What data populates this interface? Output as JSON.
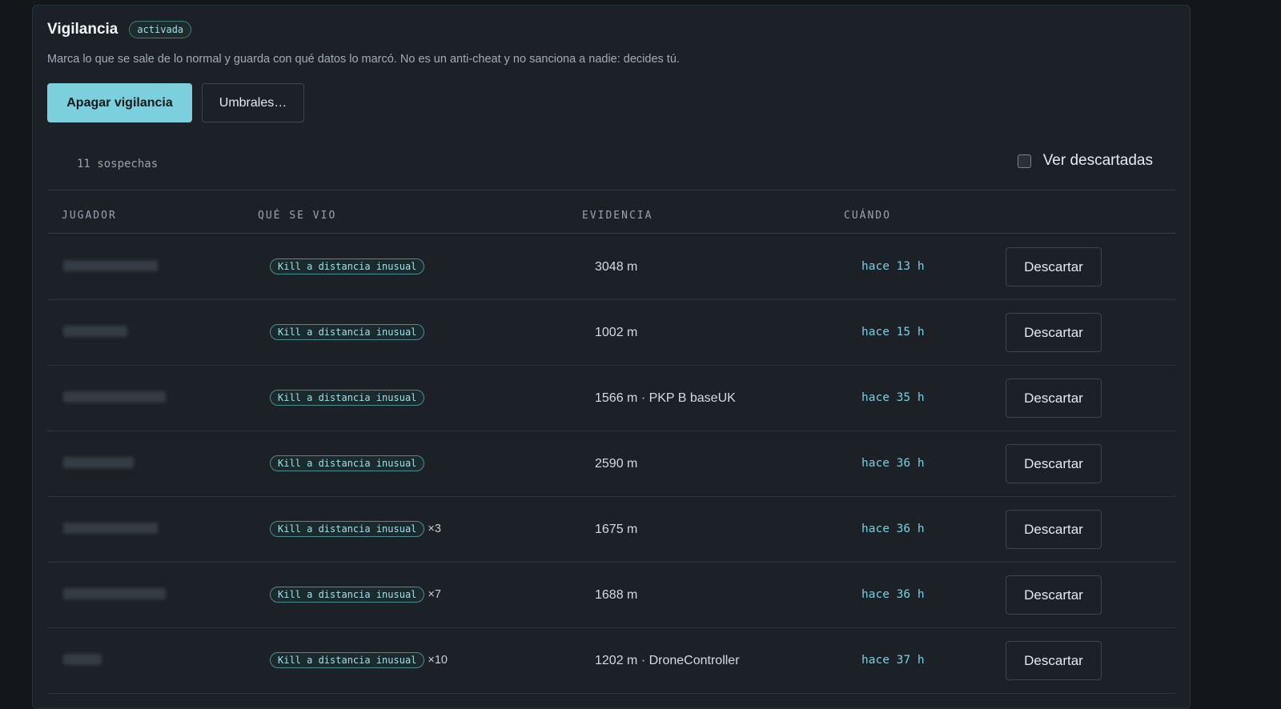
{
  "panel": {
    "title": "Vigilancia",
    "status": "activada",
    "description": "Marca lo que se sale de lo normal y guarda con qué datos lo marcó. No es un anti-cheat y no sanciona a nadie: decides tú.",
    "primary_button": "Apagar vigilancia",
    "secondary_button": "Umbrales…"
  },
  "summary": {
    "count_label": "11 sospechas",
    "show_dismissed_label": "Ver descartadas",
    "show_dismissed_checked": false
  },
  "table": {
    "headers": [
      "JUGADOR",
      "QUÉ SE VIO",
      "EVIDENCIA",
      "CUÁNDO"
    ],
    "rows": [
      {
        "player": "",
        "what": "Kill a distancia inusual",
        "mult": "",
        "evidence": "3048 m",
        "when": "hace 13 h",
        "action": "Descartar"
      },
      {
        "player": "",
        "what": "Kill a distancia inusual",
        "mult": "",
        "evidence": "1002 m",
        "when": "hace 15 h",
        "action": "Descartar"
      },
      {
        "player": "",
        "what": "Kill a distancia inusual",
        "mult": "",
        "evidence": "1566 m · PKP B baseUK",
        "when": "hace 35 h",
        "action": "Descartar"
      },
      {
        "player": "",
        "what": "Kill a distancia inusual",
        "mult": "",
        "evidence": "2590 m",
        "when": "hace 36 h",
        "action": "Descartar"
      },
      {
        "player": "",
        "what": "Kill a distancia inusual",
        "mult": "×3",
        "evidence": "1675 m",
        "when": "hace 36 h",
        "action": "Descartar"
      },
      {
        "player": "",
        "what": "Kill a distancia inusual",
        "mult": "×7",
        "evidence": "1688 m",
        "when": "hace 36 h",
        "action": "Descartar"
      },
      {
        "player": "",
        "what": "Kill a distancia inusual",
        "mult": "×10",
        "evidence": "1202 m · DroneController",
        "when": "hace 37 h",
        "action": "Descartar"
      }
    ]
  },
  "colors": {
    "accent": "#7ccfdc",
    "background": "#13171c",
    "panel": "#1b2127"
  }
}
